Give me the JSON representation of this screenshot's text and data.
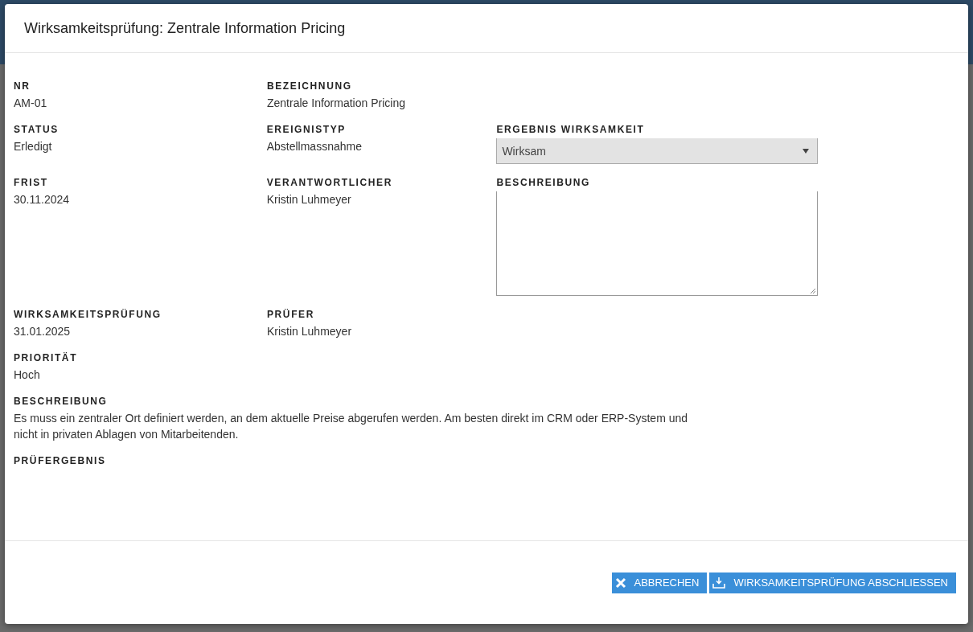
{
  "dialog": {
    "title": "Wirksamkeitsprüfung: Zentrale Information Pricing"
  },
  "rows": [
    [
      {
        "kind": "text",
        "label": "NR",
        "value": "AM-01"
      },
      {
        "kind": "text",
        "label": "BEZEICHNUNG",
        "value": "Zentrale Information Pricing"
      }
    ],
    [
      {
        "kind": "text",
        "label": "STATUS",
        "value": "Erledigt"
      },
      {
        "kind": "text",
        "label": "EREIGNISTYP",
        "value": "Abstellmassnahme"
      },
      {
        "kind": "select",
        "label": "ERGEBNIS WIRKSAMKEIT",
        "value": "Wirksam"
      }
    ],
    [
      {
        "kind": "text",
        "label": "FRIST",
        "value": "30.11.2024"
      },
      {
        "kind": "text",
        "label": "VERANTWORTLICHER",
        "value": "Kristin Luhmeyer"
      },
      {
        "kind": "textarea",
        "label": "BESCHREIBUNG"
      }
    ],
    [
      {
        "kind": "text",
        "label": "WIRKSAMKEITSPRÜFUNG",
        "value": "31.01.2025"
      },
      {
        "kind": "text",
        "label": "PRÜFER",
        "value": "Kristin Luhmeyer"
      }
    ],
    [
      {
        "kind": "text",
        "label": "PRIORITÄT",
        "value": "Hoch"
      }
    ],
    [
      {
        "kind": "paragraph",
        "label": "BESCHREIBUNG",
        "value": "Es muss ein zentraler Ort definiert werden, an dem aktuelle Preise abgerufen werden. Am besten direkt im CRM oder ERP-System und nicht in privaten Ablagen von Mitarbeitenden."
      }
    ],
    [
      {
        "kind": "text",
        "label": "PRÜFERGEBNIS"
      }
    ]
  ],
  "buttons": [
    {
      "kind": "cancel",
      "label": "ABBRECHEN"
    },
    {
      "kind": "submit",
      "label": "WIRKSAMKEITSPRÜFUNG ABSCHLIESSEN"
    }
  ]
}
